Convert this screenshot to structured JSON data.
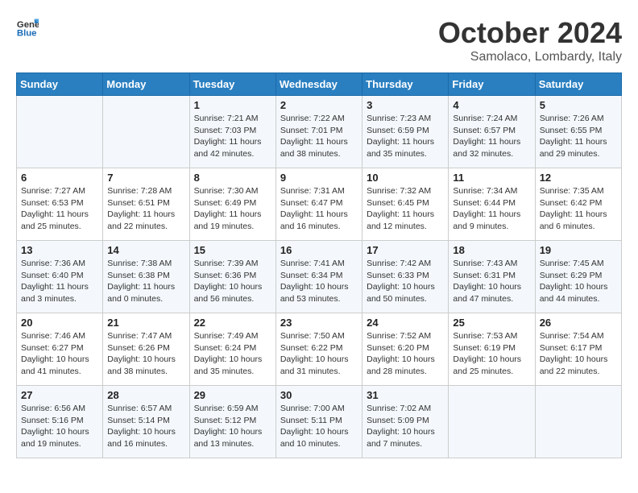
{
  "header": {
    "logo_general": "General",
    "logo_blue": "Blue",
    "title": "October 2024",
    "subtitle": "Samolaco, Lombardy, Italy"
  },
  "weekdays": [
    "Sunday",
    "Monday",
    "Tuesday",
    "Wednesday",
    "Thursday",
    "Friday",
    "Saturday"
  ],
  "weeks": [
    [
      {
        "day": "",
        "info": ""
      },
      {
        "day": "",
        "info": ""
      },
      {
        "day": "1",
        "info": "Sunrise: 7:21 AM\nSunset: 7:03 PM\nDaylight: 11 hours and 42 minutes."
      },
      {
        "day": "2",
        "info": "Sunrise: 7:22 AM\nSunset: 7:01 PM\nDaylight: 11 hours and 38 minutes."
      },
      {
        "day": "3",
        "info": "Sunrise: 7:23 AM\nSunset: 6:59 PM\nDaylight: 11 hours and 35 minutes."
      },
      {
        "day": "4",
        "info": "Sunrise: 7:24 AM\nSunset: 6:57 PM\nDaylight: 11 hours and 32 minutes."
      },
      {
        "day": "5",
        "info": "Sunrise: 7:26 AM\nSunset: 6:55 PM\nDaylight: 11 hours and 29 minutes."
      }
    ],
    [
      {
        "day": "6",
        "info": "Sunrise: 7:27 AM\nSunset: 6:53 PM\nDaylight: 11 hours and 25 minutes."
      },
      {
        "day": "7",
        "info": "Sunrise: 7:28 AM\nSunset: 6:51 PM\nDaylight: 11 hours and 22 minutes."
      },
      {
        "day": "8",
        "info": "Sunrise: 7:30 AM\nSunset: 6:49 PM\nDaylight: 11 hours and 19 minutes."
      },
      {
        "day": "9",
        "info": "Sunrise: 7:31 AM\nSunset: 6:47 PM\nDaylight: 11 hours and 16 minutes."
      },
      {
        "day": "10",
        "info": "Sunrise: 7:32 AM\nSunset: 6:45 PM\nDaylight: 11 hours and 12 minutes."
      },
      {
        "day": "11",
        "info": "Sunrise: 7:34 AM\nSunset: 6:44 PM\nDaylight: 11 hours and 9 minutes."
      },
      {
        "day": "12",
        "info": "Sunrise: 7:35 AM\nSunset: 6:42 PM\nDaylight: 11 hours and 6 minutes."
      }
    ],
    [
      {
        "day": "13",
        "info": "Sunrise: 7:36 AM\nSunset: 6:40 PM\nDaylight: 11 hours and 3 minutes."
      },
      {
        "day": "14",
        "info": "Sunrise: 7:38 AM\nSunset: 6:38 PM\nDaylight: 11 hours and 0 minutes."
      },
      {
        "day": "15",
        "info": "Sunrise: 7:39 AM\nSunset: 6:36 PM\nDaylight: 10 hours and 56 minutes."
      },
      {
        "day": "16",
        "info": "Sunrise: 7:41 AM\nSunset: 6:34 PM\nDaylight: 10 hours and 53 minutes."
      },
      {
        "day": "17",
        "info": "Sunrise: 7:42 AM\nSunset: 6:33 PM\nDaylight: 10 hours and 50 minutes."
      },
      {
        "day": "18",
        "info": "Sunrise: 7:43 AM\nSunset: 6:31 PM\nDaylight: 10 hours and 47 minutes."
      },
      {
        "day": "19",
        "info": "Sunrise: 7:45 AM\nSunset: 6:29 PM\nDaylight: 10 hours and 44 minutes."
      }
    ],
    [
      {
        "day": "20",
        "info": "Sunrise: 7:46 AM\nSunset: 6:27 PM\nDaylight: 10 hours and 41 minutes."
      },
      {
        "day": "21",
        "info": "Sunrise: 7:47 AM\nSunset: 6:26 PM\nDaylight: 10 hours and 38 minutes."
      },
      {
        "day": "22",
        "info": "Sunrise: 7:49 AM\nSunset: 6:24 PM\nDaylight: 10 hours and 35 minutes."
      },
      {
        "day": "23",
        "info": "Sunrise: 7:50 AM\nSunset: 6:22 PM\nDaylight: 10 hours and 31 minutes."
      },
      {
        "day": "24",
        "info": "Sunrise: 7:52 AM\nSunset: 6:20 PM\nDaylight: 10 hours and 28 minutes."
      },
      {
        "day": "25",
        "info": "Sunrise: 7:53 AM\nSunset: 6:19 PM\nDaylight: 10 hours and 25 minutes."
      },
      {
        "day": "26",
        "info": "Sunrise: 7:54 AM\nSunset: 6:17 PM\nDaylight: 10 hours and 22 minutes."
      }
    ],
    [
      {
        "day": "27",
        "info": "Sunrise: 6:56 AM\nSunset: 5:16 PM\nDaylight: 10 hours and 19 minutes."
      },
      {
        "day": "28",
        "info": "Sunrise: 6:57 AM\nSunset: 5:14 PM\nDaylight: 10 hours and 16 minutes."
      },
      {
        "day": "29",
        "info": "Sunrise: 6:59 AM\nSunset: 5:12 PM\nDaylight: 10 hours and 13 minutes."
      },
      {
        "day": "30",
        "info": "Sunrise: 7:00 AM\nSunset: 5:11 PM\nDaylight: 10 hours and 10 minutes."
      },
      {
        "day": "31",
        "info": "Sunrise: 7:02 AM\nSunset: 5:09 PM\nDaylight: 10 hours and 7 minutes."
      },
      {
        "day": "",
        "info": ""
      },
      {
        "day": "",
        "info": ""
      }
    ]
  ]
}
